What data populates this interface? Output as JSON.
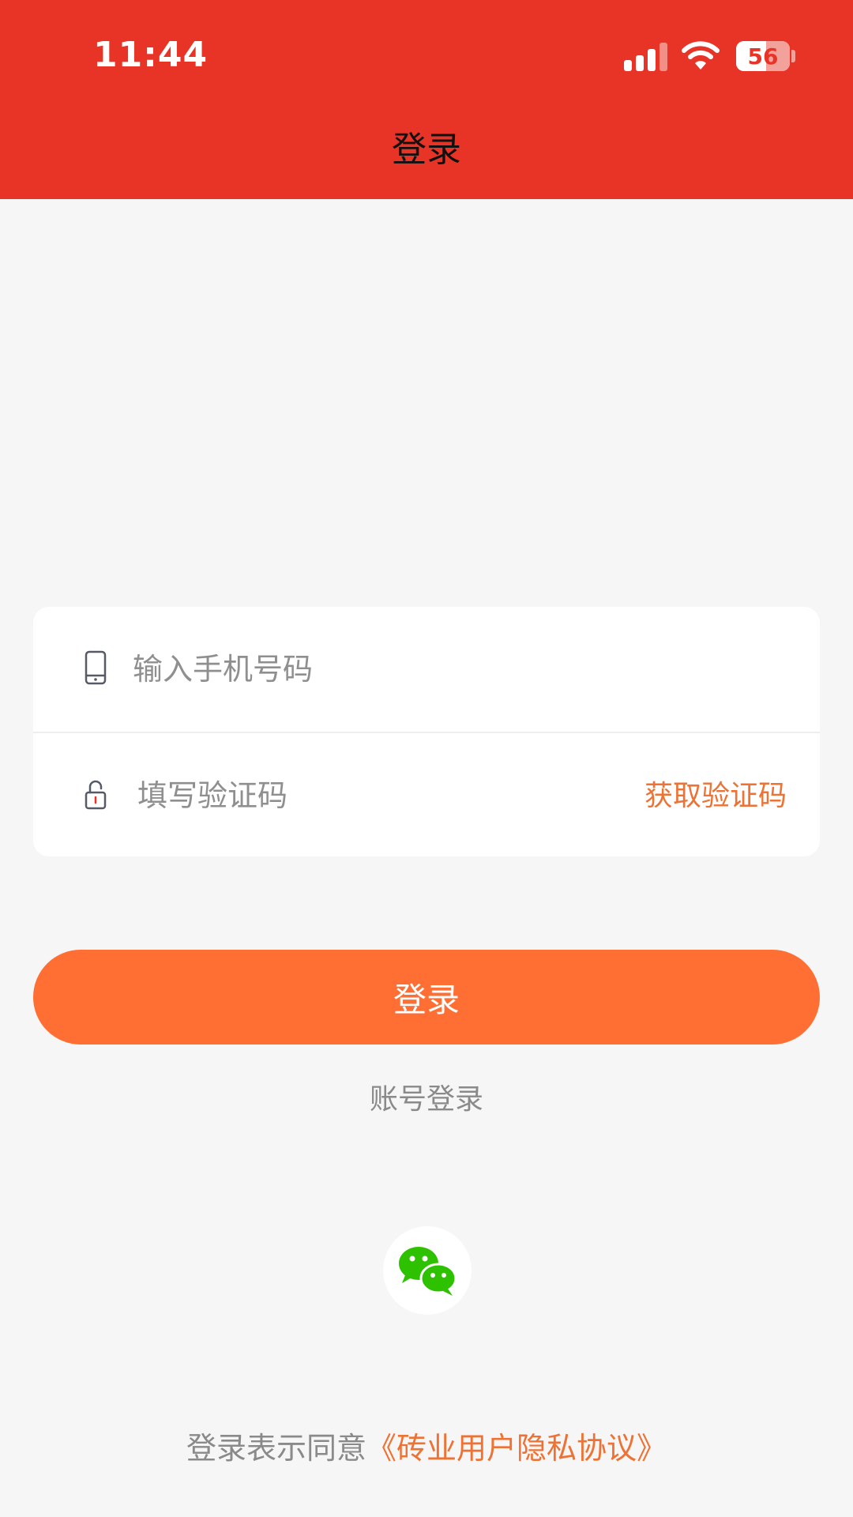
{
  "status_bar": {
    "time": "11:44",
    "battery_level": "56",
    "battery_fraction": 0.56
  },
  "header": {
    "title": "登录",
    "background_color": "#e83426"
  },
  "form": {
    "phone": {
      "placeholder": "输入手机号码",
      "icon": "phone-icon"
    },
    "code": {
      "placeholder": "填写验证码",
      "icon": "lock-icon",
      "get_code_label": "获取验证码"
    }
  },
  "login_button": {
    "label": "登录",
    "color": "#ff6e32"
  },
  "account_login": {
    "label": "账号登录"
  },
  "wechat": {
    "icon": "wechat-icon",
    "color": "#2dc100"
  },
  "agreement": {
    "prefix": "登录表示同意",
    "link": "《砖业用户隐私协议》"
  },
  "colors": {
    "accent": "#ee7234",
    "background": "#f6f6f6"
  }
}
